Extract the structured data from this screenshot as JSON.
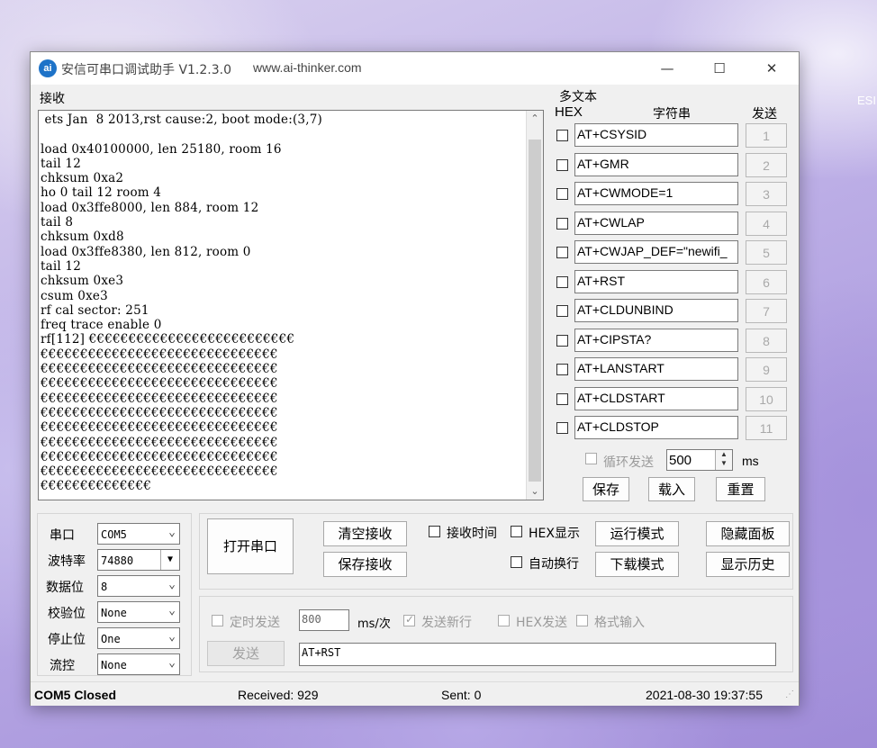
{
  "wallpaper_text": "ESI",
  "window": {
    "title": "安信可串口调试助手 V1.2.3.0",
    "url": "www.ai-thinker.com",
    "icon_label": "ai",
    "minimize": "—",
    "maximize": "☐",
    "close": "✕"
  },
  "receive": {
    "label": "接收",
    "lines": [
      " ets Jan  8 2013,rst cause:2, boot mode:(3,7)",
      "",
      "load 0x40100000, len 25180, room 16",
      "tail 12",
      "chksum 0xa2",
      "ho 0 tail 12 room 4",
      "load 0x3ffe8000, len 884, room 12",
      "tail 8",
      "chksum 0xd8",
      "load 0x3ffe8380, len 812, room 0",
      "tail 12",
      "chksum 0xe3",
      "csum 0xe3",
      "rf cal sector: 251",
      "freq trace enable 0",
      "rf[112] €€€€€€€€€€€€€€€€€€€€€€€€€€",
      "€€€€€€€€€€€€€€€€€€€€€€€€€€€€€€",
      "€€€€€€€€€€€€€€€€€€€€€€€€€€€€€€",
      "€€€€€€€€€€€€€€€€€€€€€€€€€€€€€€",
      "€€€€€€€€€€€€€€€€€€€€€€€€€€€€€€",
      "€€€€€€€€€€€€€€€€€€€€€€€€€€€€€€",
      "€€€€€€€€€€€€€€€€€€€€€€€€€€€€€€",
      "€€€€€€€€€€€€€€€€€€€€€€€€€€€€€€",
      "€€€€€€€€€€€€€€€€€€€€€€€€€€€€€€",
      "€€€€€€€€€€€€€€€€€€€€€€€€€€€€€€",
      "€€€€€€€€€€€€€€"
    ]
  },
  "multi": {
    "label": "多文本",
    "col_hex": "HEX",
    "col_string": "字符串",
    "col_send": "发送",
    "rows": [
      {
        "text": "AT+CSYSID",
        "num": "1"
      },
      {
        "text": "AT+GMR",
        "num": "2"
      },
      {
        "text": "AT+CWMODE=1",
        "num": "3"
      },
      {
        "text": "AT+CWLAP",
        "num": "4"
      },
      {
        "text": "AT+CWJAP_DEF=\"newifi_",
        "num": "5"
      },
      {
        "text": "AT+RST",
        "num": "6"
      },
      {
        "text": "AT+CLDUNBIND",
        "num": "7"
      },
      {
        "text": "AT+CIPSTA?",
        "num": "8"
      },
      {
        "text": "AT+LANSTART",
        "num": "9"
      },
      {
        "text": "AT+CLDSTART",
        "num": "10"
      },
      {
        "text": "AT+CLDSTOP",
        "num": "11"
      }
    ],
    "loop_label": "循环发送",
    "loop_value": "500",
    "loop_unit": "ms",
    "save": "保存",
    "load": "载入",
    "reset": "重置"
  },
  "serial": {
    "port_label": "串口",
    "port_value": "COM5",
    "baud_label": "波特率",
    "baud_value": "74880",
    "databits_label": "数据位",
    "databits_value": "8",
    "parity_label": "校验位",
    "parity_value": "None",
    "stopbits_label": "停止位",
    "stopbits_value": "One",
    "flow_label": "流控",
    "flow_value": "None"
  },
  "controls": {
    "open_port": "打开串口",
    "clear_recv": "清空接收",
    "save_recv": "保存接收",
    "recv_time": "接收时间",
    "hex_display": "HEX显示",
    "run_mode": "运行模式",
    "hide_panel": "隐藏面板",
    "auto_wrap": "自动换行",
    "download_mode": "下载模式",
    "show_history": "显示历史"
  },
  "send": {
    "timed_send": "定时发送",
    "interval": "800",
    "interval_unit": "ms/次",
    "newline": "发送新行",
    "hex_send": "HEX发送",
    "format_input": "格式输入",
    "send_button": "发送",
    "input_value": "AT+RST"
  },
  "status": {
    "port": "COM5 Closed",
    "received": "Received: 929",
    "sent": "Sent: 0",
    "datetime": "2021-08-30 19:37:55"
  }
}
